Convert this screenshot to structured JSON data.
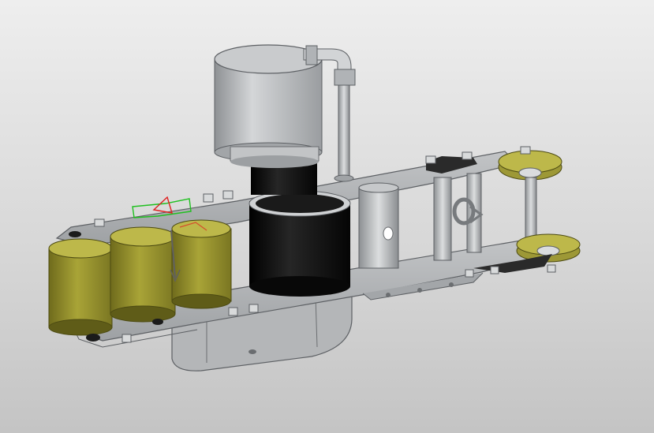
{
  "viewport": {
    "background_top": "#eeeeee",
    "background_bottom": "#c4c4c4"
  },
  "model": {
    "colors": {
      "frame_plate": "#a9acaf",
      "frame_edge": "#5d6064",
      "roller_olive": "#8e8a2a",
      "roller_olive_light": "#b0ab3c",
      "drive_drum": "#0d0d0d",
      "motor_housing": "#b8babc",
      "axis_x": "#e02020",
      "axis_y": "#20c020",
      "axis_z": "#606060"
    },
    "parts": [
      "motor-cylinder",
      "elbow-fitting",
      "support-rod",
      "drive-drum",
      "gear-housing",
      "roller-stack",
      "wheel-assembly",
      "side-plate"
    ]
  }
}
